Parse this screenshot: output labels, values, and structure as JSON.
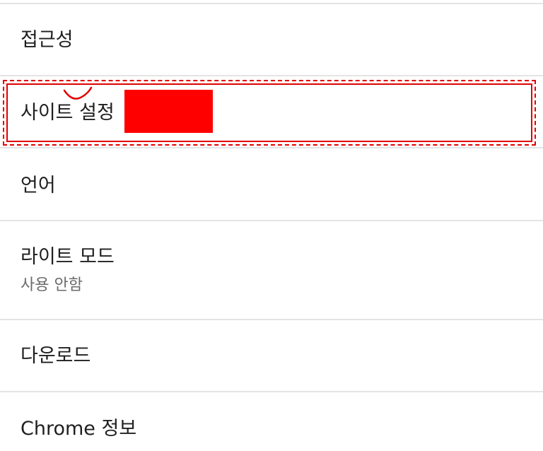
{
  "settings": {
    "items": [
      {
        "title": "접근성"
      },
      {
        "title": "사이트 설정"
      },
      {
        "title": "언어"
      },
      {
        "title": "라이트 모드",
        "subtitle": "사용 안함"
      },
      {
        "title": "다운로드"
      },
      {
        "title": "Chrome 정보"
      }
    ]
  },
  "annotations": {
    "highlight_color": "#e00000",
    "redaction_color": "#ff0000"
  }
}
